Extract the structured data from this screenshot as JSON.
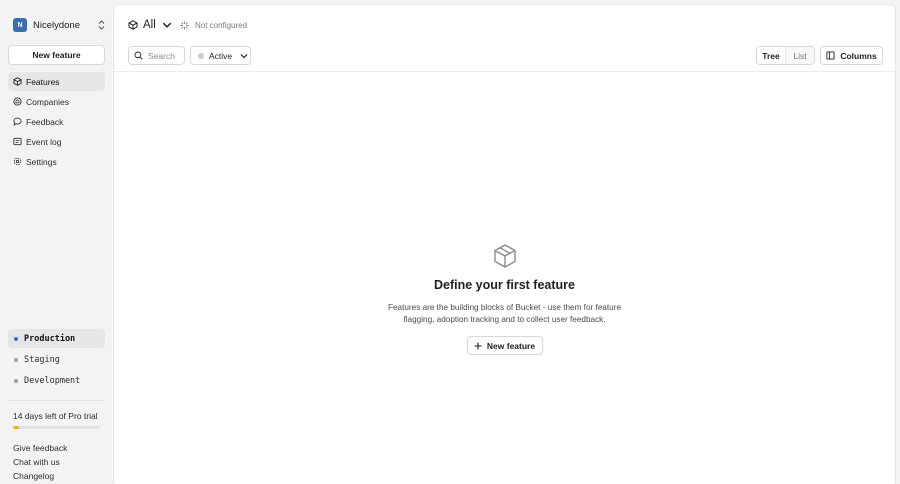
{
  "org": {
    "initial": "N",
    "name": "Nicelydone",
    "avatar_color": "#3a6dab"
  },
  "sidebar": {
    "new_feature_label": "New feature",
    "items": [
      {
        "label": "Features",
        "icon": "cube-icon",
        "active": true
      },
      {
        "label": "Companies",
        "icon": "building-icon",
        "active": false
      },
      {
        "label": "Feedback",
        "icon": "chat-icon",
        "active": false
      },
      {
        "label": "Event log",
        "icon": "list-icon",
        "active": false
      },
      {
        "label": "Settings",
        "icon": "gear-icon",
        "active": false
      }
    ],
    "environments": [
      {
        "label": "Production",
        "active": true,
        "dot_color": "#2f6fd0"
      },
      {
        "label": "Staging",
        "active": false,
        "dot_color": "#9a9ba2"
      },
      {
        "label": "Development",
        "active": false,
        "dot_color": "#9a9ba2"
      }
    ],
    "trial": {
      "text": "14 days left of Pro trial",
      "progress": 0.07,
      "color": "#f0b323"
    },
    "footer_links": [
      "Give feedback",
      "Chat with us",
      "Changelog"
    ]
  },
  "header": {
    "scope_label": "All",
    "status_text": "Not configured"
  },
  "toolbar": {
    "search_placeholder": "Search",
    "status_filter": "Active",
    "views": [
      "Tree",
      "List"
    ],
    "active_view": "Tree",
    "columns_label": "Columns"
  },
  "empty_state": {
    "icon": "cube-icon",
    "title": "Define your first feature",
    "description": "Features are the building blocks of Bucket - use them for feature flagging, adoption tracking and to collect user feedback.",
    "button_label": "New feature"
  }
}
